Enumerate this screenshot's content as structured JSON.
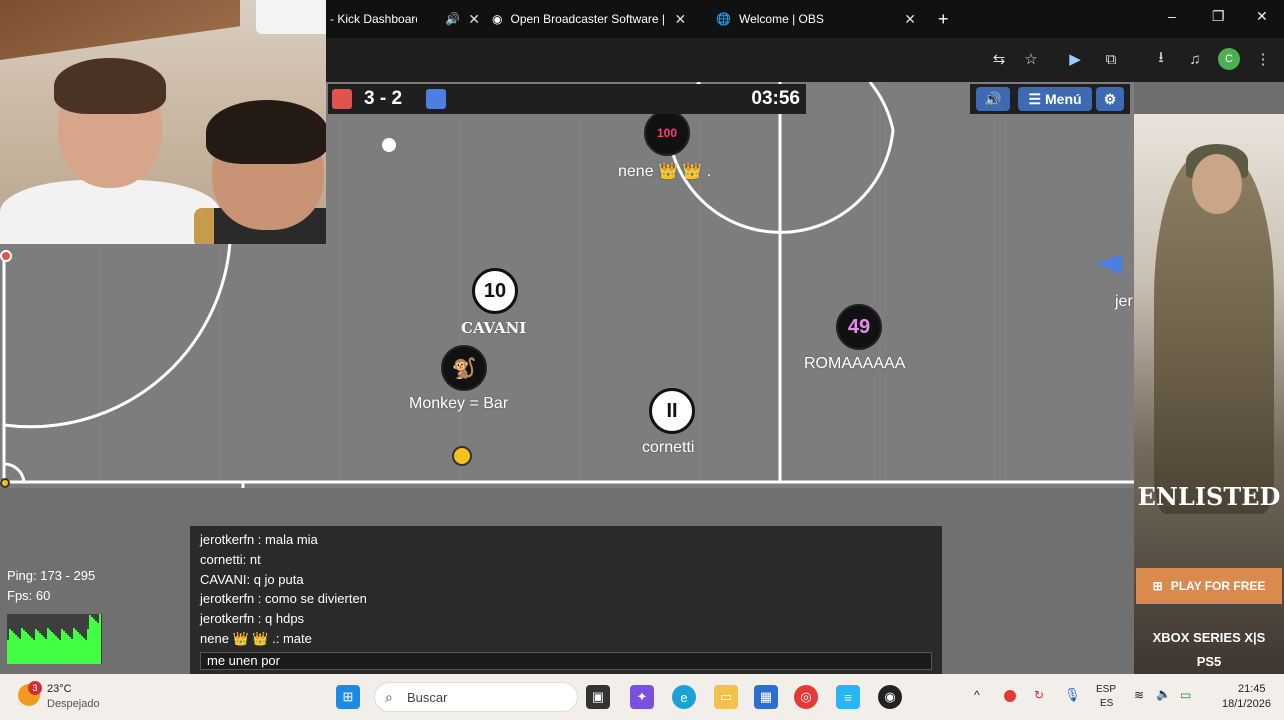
{
  "browser": {
    "tabs": [
      {
        "title": "- Kick Dashboard",
        "audio_icon": "speaker-icon"
      },
      {
        "title": "Open Broadcaster Software | O",
        "icon": "obs-icon"
      },
      {
        "title": "Welcome | OBS",
        "icon": "globe-icon"
      }
    ],
    "new_tab": "+",
    "window_controls": [
      "–",
      "❐",
      "✕"
    ],
    "profile_initial": "C"
  },
  "game": {
    "score": "3 - 2",
    "time": "03:56",
    "red_color": "#e0534f",
    "blue_color": "#4d7fe0",
    "menu_label": "Menú",
    "players": [
      {
        "number": "10",
        "name": "CAVANI",
        "style": "white"
      },
      {
        "number": "",
        "name": "Monkey = Bar",
        "style": "dark"
      },
      {
        "number": "II",
        "name": "cornetti",
        "style": "white"
      },
      {
        "number": "49",
        "name": "ROMAAAAAA",
        "style": "dark"
      },
      {
        "number": "100",
        "name": "nene 👑 👑 .",
        "style": "dark"
      },
      {
        "number": "",
        "name": "jer",
        "style": "edge"
      }
    ]
  },
  "stats": {
    "ping": "Ping: 173 - 295",
    "fps": "Fps: 60"
  },
  "chat": {
    "lines": [
      {
        "text": "jerotkerfn : mala mia"
      },
      {
        "text": "cornetti: nt"
      },
      {
        "text": "CAVANI: q jo puta"
      },
      {
        "text": "jerotkerfn : como se divierten"
      },
      {
        "text": "jerotkerfn : q hdps"
      },
      {
        "text": "nene 👑 👑 .: mate"
      }
    ],
    "input_value": "me unen por"
  },
  "ad": {
    "brand": "ENLISTED",
    "cta": "PLAY FOR FREE",
    "platform1": "XBOX SERIES X|S",
    "platform2": "PS5"
  },
  "taskbar": {
    "weather_temp": "23°C",
    "weather_desc": "Despejado",
    "weather_badge": "3",
    "search_placeholder": "Buscar",
    "lang_top": "ESP",
    "lang_bottom": "ES",
    "time": "21:45",
    "date": "18/1/2026"
  }
}
